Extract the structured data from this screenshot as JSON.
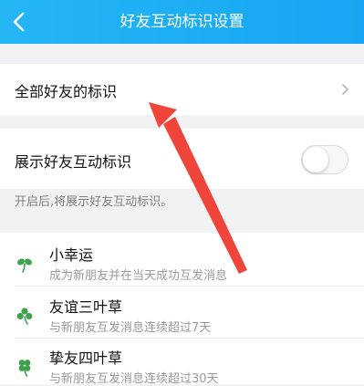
{
  "header": {
    "title": "好友互动标识设置",
    "back_icon": "chevron-left-icon"
  },
  "all_friends_row": {
    "label": "全部好友的标识",
    "chevron_icon": "chevron-right-icon"
  },
  "show_marks_row": {
    "label": "展示好友互动标识",
    "toggle_on": false
  },
  "hint": "开启后,将展示好友互动标识。",
  "marks": [
    {
      "icon": "two-leaf-clover-icon",
      "title": "小幸运",
      "desc": "成为新朋友并在当天成功互发消息"
    },
    {
      "icon": "three-leaf-clover-icon",
      "title": "友谊三叶草",
      "desc": "与新朋友互发消息连续超过7天"
    },
    {
      "icon": "four-leaf-clover-icon",
      "title": "挚友四叶草",
      "desc": "与新朋友互发消息连续超过30天"
    }
  ],
  "colors": {
    "header_bg": "#1aabf4",
    "page_bg": "#f2f2f4",
    "clover": "#3fa34d",
    "annotation_arrow": "#f0453a"
  }
}
